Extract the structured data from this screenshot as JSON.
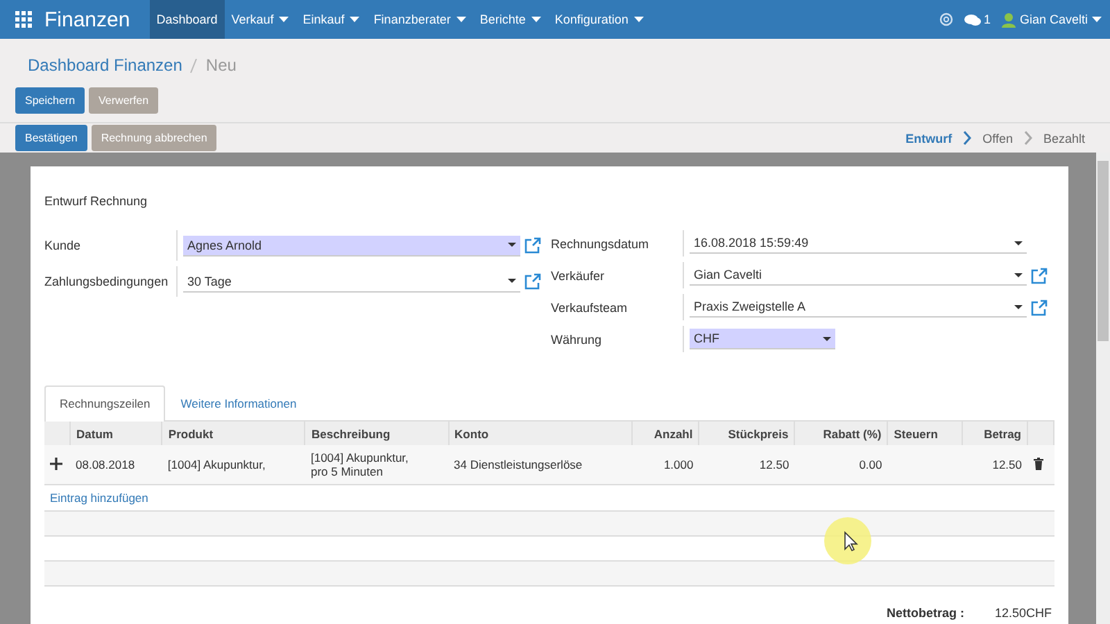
{
  "navbar": {
    "app_title": "Finanzen",
    "menus": [
      {
        "label": "Dashboard",
        "selected": true,
        "dropdown": false
      },
      {
        "label": "Verkauf",
        "selected": false,
        "dropdown": true
      },
      {
        "label": "Einkauf",
        "selected": false,
        "dropdown": true
      },
      {
        "label": "Finanzberater",
        "selected": false,
        "dropdown": true
      },
      {
        "label": "Berichte",
        "selected": false,
        "dropdown": true
      },
      {
        "label": "Konfiguration",
        "selected": false,
        "dropdown": true
      }
    ],
    "message_count": "1",
    "user": "Gian Cavelti"
  },
  "breadcrumb": [
    {
      "label": "Dashboard Finanzen",
      "link": true
    },
    {
      "label": "Neu",
      "link": false
    }
  ],
  "buttons": [
    {
      "label": "Speichern",
      "kind": "primary"
    },
    {
      "label": "Verwerfen",
      "kind": "secondary"
    }
  ],
  "status_buttons": [
    {
      "label": "Bestätigen",
      "kind": "primary"
    },
    {
      "label": "Rechnung abbrechen",
      "kind": "secondary"
    }
  ],
  "stages": [
    {
      "label": "Entwurf",
      "selected": true
    },
    {
      "label": "Offen",
      "selected": false
    },
    {
      "label": "Bezahlt",
      "selected": false
    }
  ],
  "sheet": {
    "title": "Entwurf Rechnung",
    "left_fields": [
      {
        "label": "Kunde",
        "value": "Agnes Arnold",
        "required": true,
        "external_link": true
      },
      {
        "label": "Zahlungsbedingungen",
        "value": "30 Tage",
        "required": false,
        "external_link": true
      }
    ],
    "right_fields": [
      {
        "label": "Rechnungsdatum",
        "value": "16.08.2018 15:59:49",
        "required": false,
        "external_link": false,
        "short": false
      },
      {
        "label": "Verkäufer",
        "value": "Gian Cavelti",
        "required": false,
        "external_link": true,
        "short": false
      },
      {
        "label": "Verkaufsteam",
        "value": "Praxis Zweigstelle A",
        "required": false,
        "external_link": true,
        "short": false
      },
      {
        "label": "Währung",
        "value": "CHF",
        "required": true,
        "external_link": false,
        "short": true
      }
    ],
    "tabs": [
      {
        "label": "Rechnungszeilen",
        "selected": true
      },
      {
        "label": "Weitere Informationen",
        "selected": false
      }
    ],
    "table": {
      "columns": [
        "Datum",
        "Produkt",
        "Beschreibung",
        "Konto",
        "Anzahl",
        "Stückpreis",
        "Rabatt (%)",
        "Steuern",
        "Betrag"
      ],
      "rows": [
        {
          "cells": [
            "08.08.2018",
            "[1004] Akupunktur,",
            "[1004] Akupunktur,\npro 5 Minuten",
            "34 Dienstleistungserlöse",
            "1.000",
            "12.50",
            "0.00",
            "",
            "12.50"
          ]
        }
      ],
      "add_line": "Eintrag hinzufügen"
    },
    "total": {
      "label": "Nettobetrag :",
      "value": "12.50CHF"
    }
  }
}
